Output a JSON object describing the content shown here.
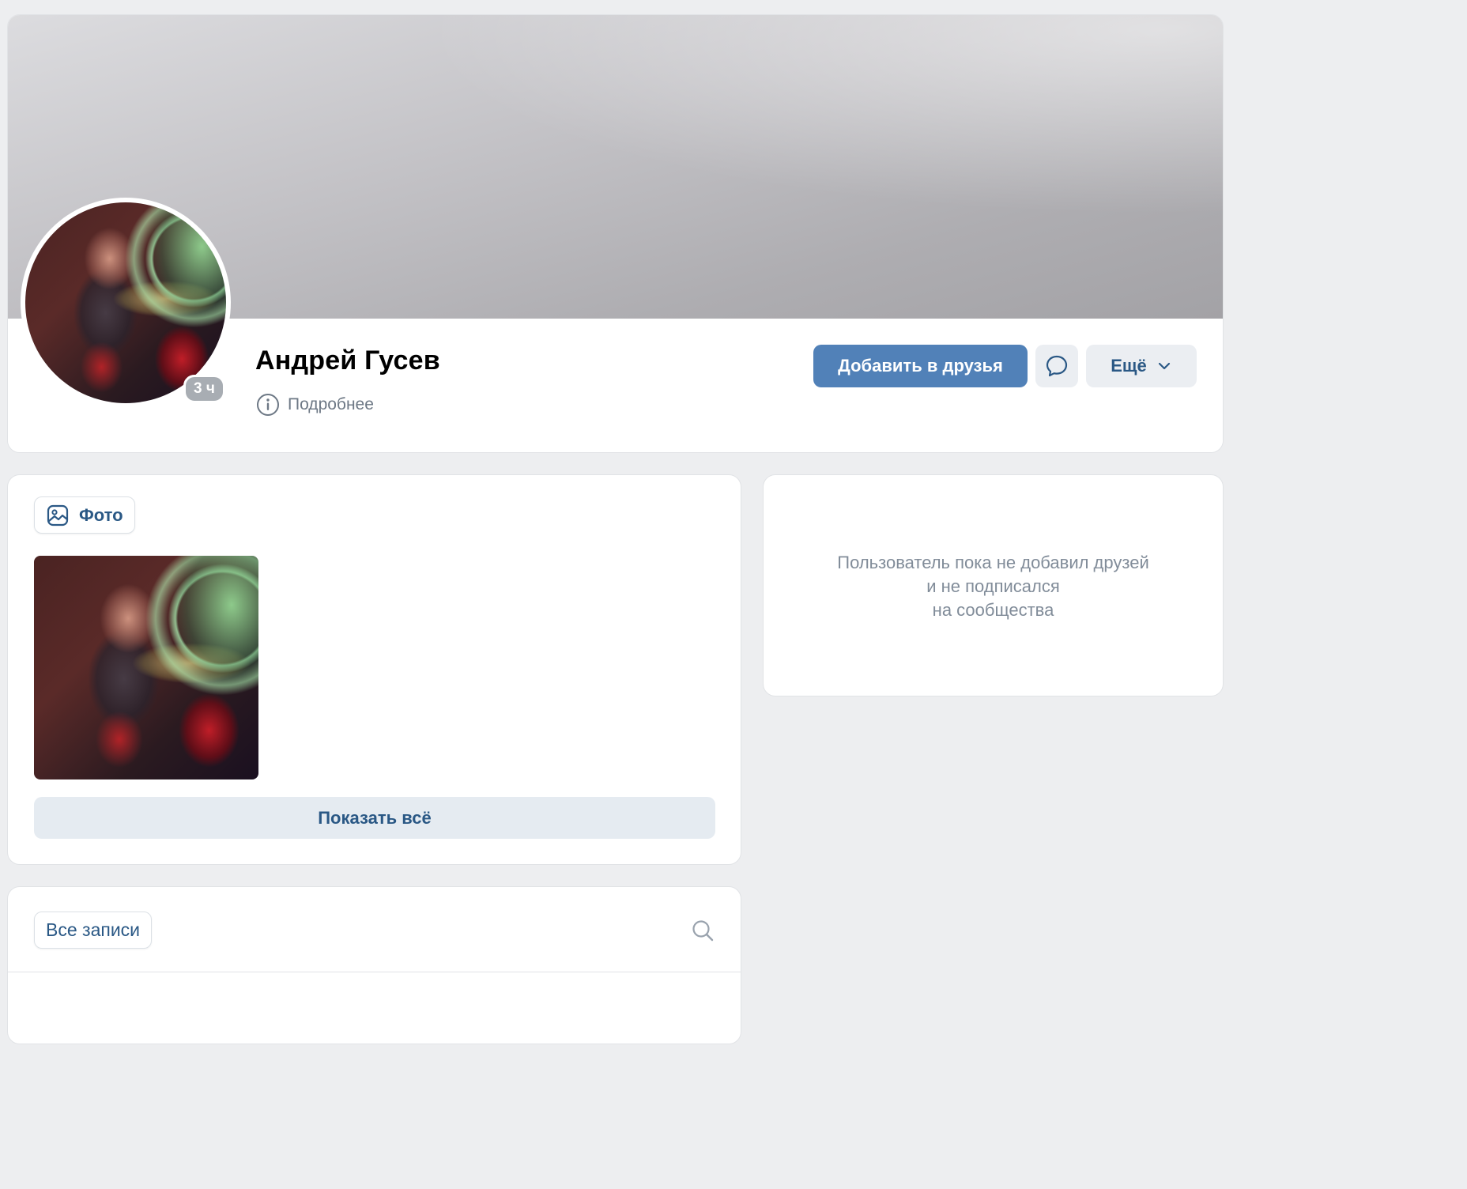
{
  "profile": {
    "name": "Андрей Гусев",
    "last_seen": "3 ч",
    "details_label": "Подробнее"
  },
  "actions": {
    "add_friend_label": "Добавить в друзья",
    "more_label": "Ещё"
  },
  "photos": {
    "tab_label": "Фото",
    "show_all_label": "Показать всё"
  },
  "friends": {
    "empty_lines": [
      "Пользователь пока не добавил друзей",
      "и не подписался",
      "на сообщества"
    ]
  },
  "wall": {
    "tab_label": "Все записи"
  },
  "colors": {
    "accent": "#5181b8",
    "link": "#2a5885",
    "background": "#edeef0",
    "secondary_text": "#818c99"
  },
  "icons": {
    "details": "info-icon",
    "message": "message-bubble-icon",
    "more": "chevron-down-icon",
    "photos": "image-icon",
    "search": "search-icon"
  }
}
